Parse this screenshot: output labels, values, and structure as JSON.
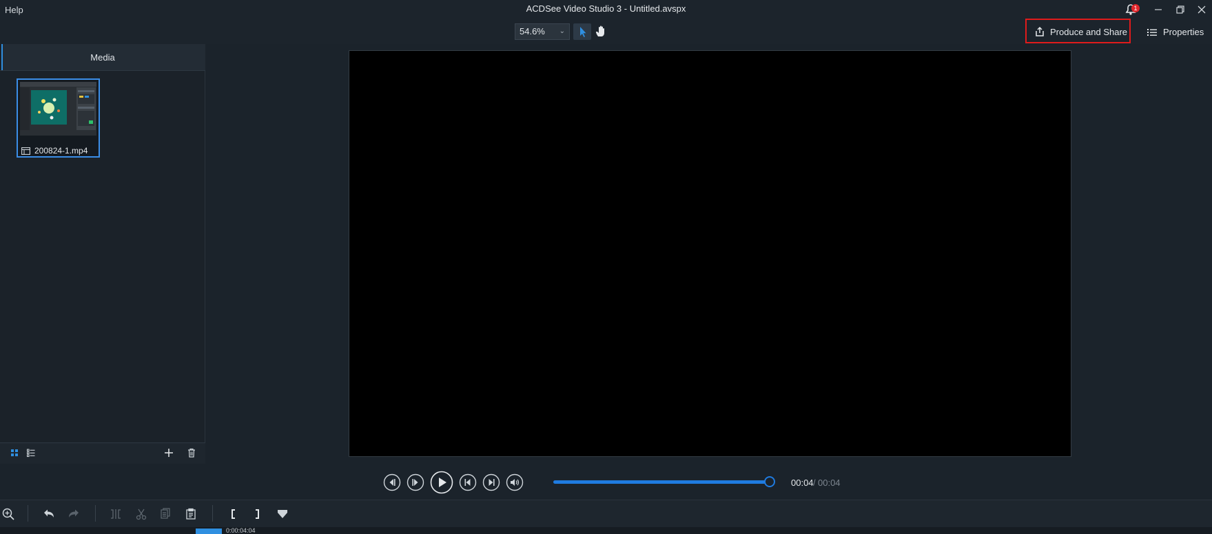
{
  "app": {
    "title": "ACDSee Video Studio 3 - Untitled.avspx",
    "menu": {
      "help": "Help"
    },
    "notification_count": "1",
    "window_controls": [
      "minimize-icon",
      "restore-icon",
      "close-icon"
    ]
  },
  "toolbar": {
    "zoom": "54.6%",
    "produce_label": "Produce and Share",
    "properties_label": "Properties"
  },
  "media_panel": {
    "tab_label": "Media",
    "items": [
      {
        "filename": "200824-1.mp4",
        "selected": true
      }
    ]
  },
  "transport": {
    "current_time": "00:04",
    "separator": "/",
    "total_time": "00:04",
    "progress": 1.0
  },
  "timeline": {
    "playhead_time": "0:00:04:04"
  },
  "colors": {
    "accent": "#1f7be0",
    "highlight_border": "#e01b1b",
    "background": "#1b232b"
  }
}
